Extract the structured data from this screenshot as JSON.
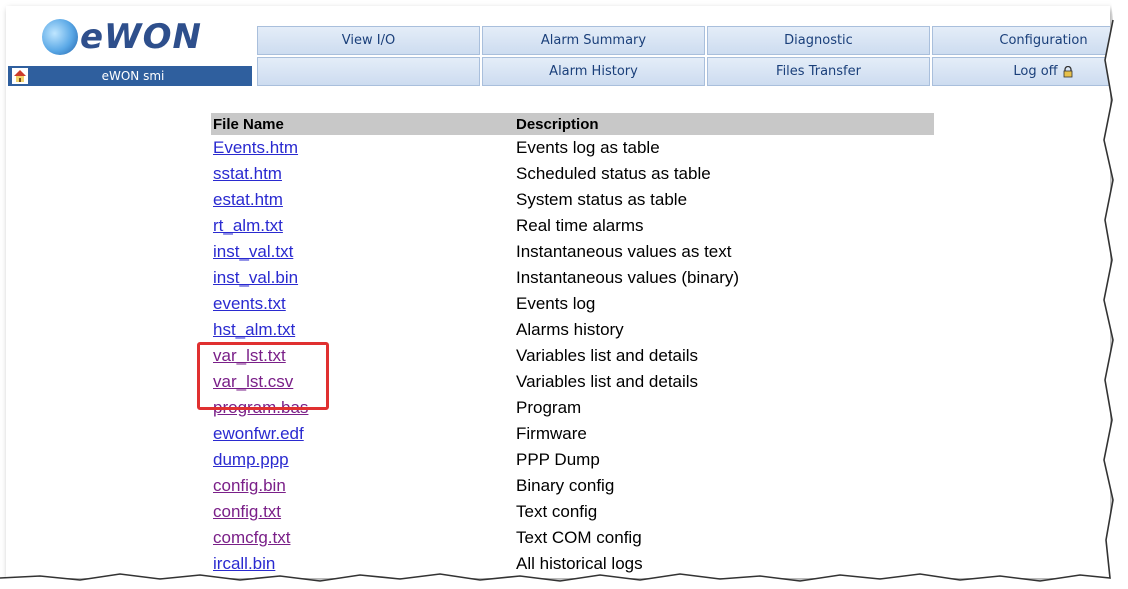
{
  "header": {
    "logo_text": "eWON",
    "device_name": "eWON smi",
    "nav_row1": [
      "View I/O",
      "Alarm Summary",
      "Diagnostic",
      "Configuration"
    ],
    "nav_row2": [
      "",
      "Alarm History",
      "Files Transfer",
      "Log off"
    ]
  },
  "table": {
    "headers": [
      "File Name",
      "Description"
    ],
    "rows": [
      {
        "file": "Events.htm",
        "desc": "Events log as table"
      },
      {
        "file": "sstat.htm",
        "desc": "Scheduled status as table"
      },
      {
        "file": "estat.htm",
        "desc": "System status as table"
      },
      {
        "file": "rt_alm.txt",
        "desc": "Real time alarms"
      },
      {
        "file": "inst_val.txt",
        "desc": "Instantaneous values as text"
      },
      {
        "file": "inst_val.bin",
        "desc": "Instantaneous values (binary)"
      },
      {
        "file": "events.txt",
        "desc": "Events log"
      },
      {
        "file": "hst_alm.txt",
        "desc": "Alarms history"
      },
      {
        "file": "var_lst.txt",
        "desc": "Variables list and details"
      },
      {
        "file": "var_lst.csv",
        "desc": "Variables list and details"
      },
      {
        "file": "program.bas",
        "desc": "Program"
      },
      {
        "file": "ewonfwr.edf",
        "desc": "Firmware"
      },
      {
        "file": "dump.ppp",
        "desc": "PPP Dump"
      },
      {
        "file": "config.bin",
        "desc": "Binary config"
      },
      {
        "file": "config.txt",
        "desc": "Text config"
      },
      {
        "file": "comcfg.txt",
        "desc": "Text COM config"
      },
      {
        "file": "ircall.bin",
        "desc": "All historical logs"
      }
    ]
  },
  "colors": {
    "link": "#2a2ad0",
    "visited_link": "#7a1f88",
    "header_bg": "#c8c8c8",
    "highlight": "#e03030",
    "home_bar": "#2f5f9e"
  },
  "icons": [
    "home-icon",
    "lock-icon"
  ]
}
